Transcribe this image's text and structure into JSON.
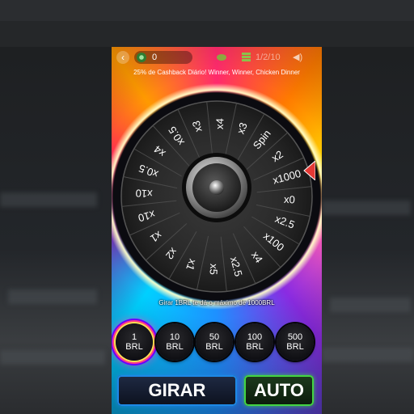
{
  "hud": {
    "back_icon": "chevron-left-icon",
    "balance": "0",
    "balance_icon": "coin-icon",
    "score_text": "1/2/10",
    "sound_icon": "speaker-icon"
  },
  "ticker": "25% de Cashback Diário! Winner, Winner, Chicken Dinner",
  "wheel": {
    "segments": [
      "Spin",
      "x2",
      "x1000",
      "x0",
      "x2.5",
      "x100",
      "x4",
      "x2.5",
      "x5",
      "x1",
      "x2",
      "x1",
      "x10",
      "x10",
      "x0.5",
      "x4",
      "x0.5",
      "x3",
      "x4",
      "x3"
    ],
    "center_icon": "speaker-icon"
  },
  "info": "Girar 1BRL te dá o máximo de 1000BRL",
  "bets": [
    {
      "amount": "1",
      "currency": "BRL",
      "selected": true
    },
    {
      "amount": "10",
      "currency": "BRL",
      "selected": false
    },
    {
      "amount": "50",
      "currency": "BRL",
      "selected": false
    },
    {
      "amount": "100",
      "currency": "BRL",
      "selected": false
    },
    {
      "amount": "500",
      "currency": "BRL",
      "selected": false
    }
  ],
  "buttons": {
    "spin": "GIRAR",
    "auto": "AUTO"
  },
  "colors": {
    "spin_border": "#1e88e5",
    "auto_border": "#43d443",
    "selected_ring": "#ffe14d"
  }
}
